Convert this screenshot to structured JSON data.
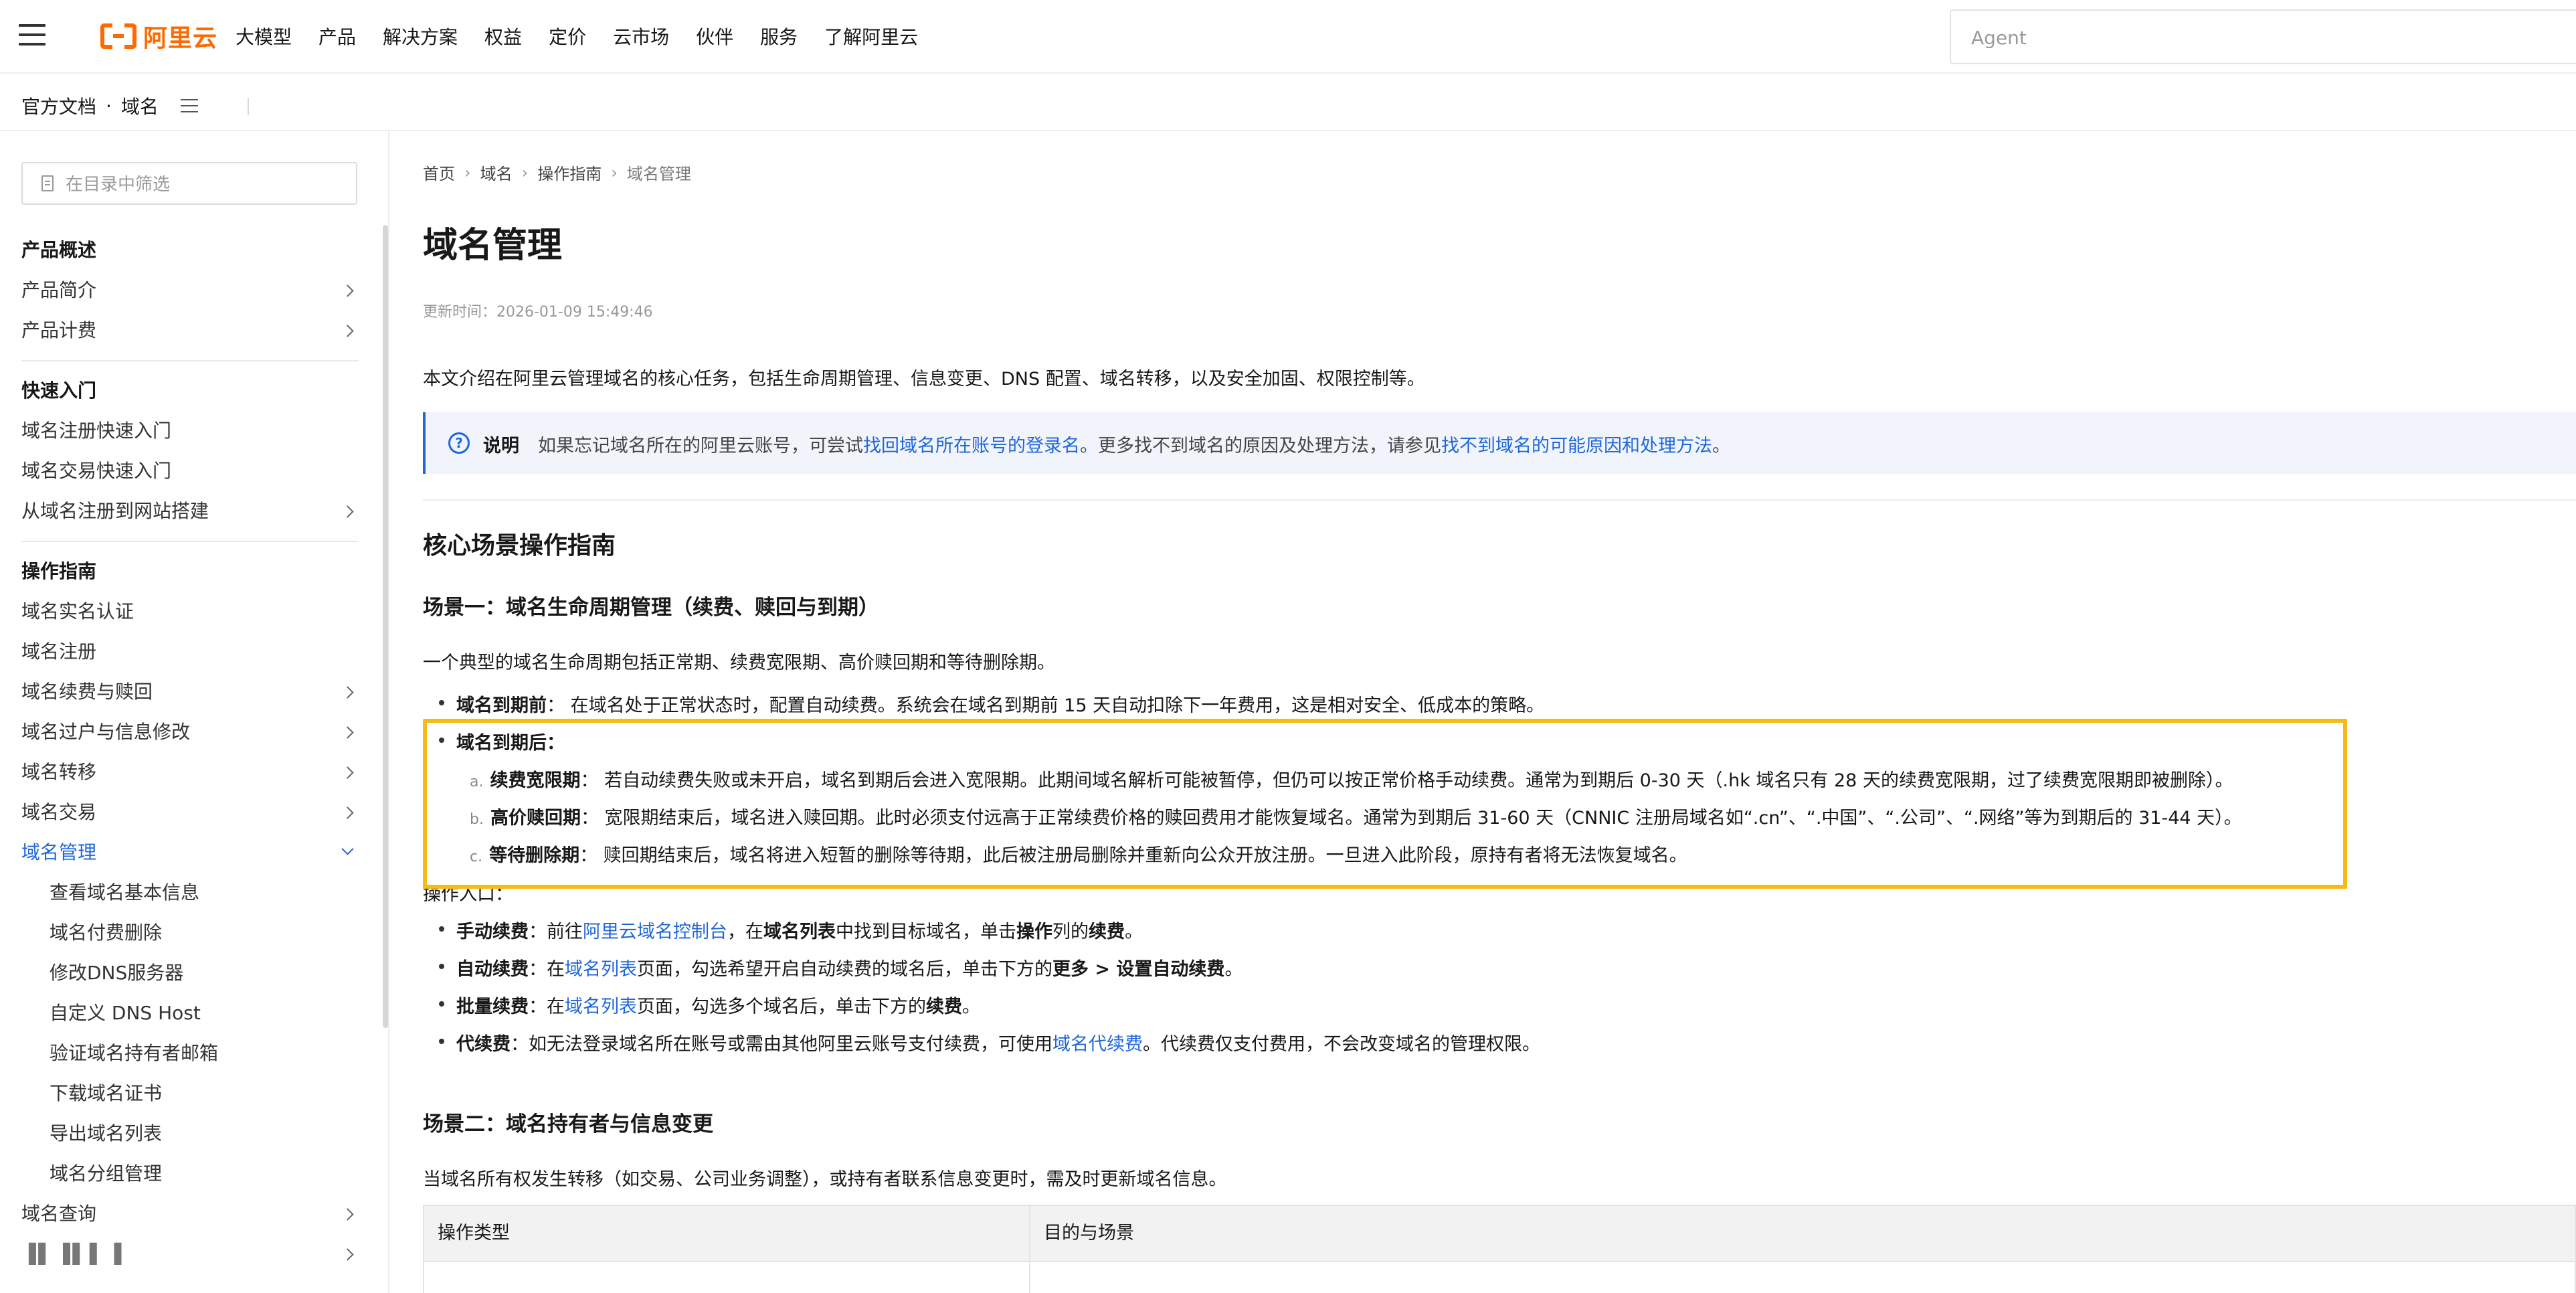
{
  "header": {
    "logo_text": "阿里云",
    "nav": [
      "大模型",
      "产品",
      "解决方案",
      "权益",
      "定价",
      "云市场",
      "伙伴",
      "服务",
      "了解阿里云"
    ],
    "agent_placeholder": "Agent"
  },
  "subheader": {
    "doc_label": "官方文档",
    "separator": "·",
    "product": "域名"
  },
  "sidebar": {
    "filter_placeholder": "在目录中筛选",
    "groups": [
      {
        "title": "产品概述",
        "items": [
          "产品简介",
          "产品计费"
        ]
      },
      {
        "title": "快速入门",
        "items": [
          "域名注册快速入门",
          "域名交易快速入门",
          "从域名注册到网站搭建"
        ]
      },
      {
        "title": "操作指南",
        "items": [
          "域名实名认证",
          "域名注册",
          "域名续费与赎回",
          "域名过户与信息修改",
          "域名转移",
          "域名交易",
          "域名管理"
        ]
      }
    ],
    "active_children": [
      "查看域名基本信息",
      "域名付费删除",
      "修改DNS服务器",
      "自定义 DNS Host",
      "验证域名持有者邮箱",
      "下载域名证书",
      "导出域名列表",
      "域名分组管理"
    ],
    "after_items": [
      "域名查询"
    ],
    "redacted_item": "▐▌▐▌▌▐"
  },
  "breadcrumb": [
    "首页",
    "域名",
    "操作指南",
    "域名管理"
  ],
  "article": {
    "title": "域名管理",
    "updated": "更新时间：2026-01-09 15:49:46",
    "intro": "本文介绍在阿里云管理域名的核心任务，包括生命周期管理、信息变更、DNS 配置、域名转移，以及安全加固、权限控制等。",
    "note": {
      "label": "说明",
      "text_1": "如果忘记域名所在的阿里云账号，可尝试",
      "link_1": "找回域名所在账号的登录名",
      "text_2": "。更多找不到域名的原因及处理方法，请参见",
      "link_2": "找不到域名的可能原因和处理方法",
      "text_3": "。"
    },
    "h2_core": "核心场景操作指南",
    "scene1_title": "场景一：域名生命周期管理（续费、赎回与到期）",
    "scene1_intro": "一个典型的域名生命周期包括正常期、续费宽限期、高价赎回期和等待删除期。",
    "before_expiry": {
      "label": "域名到期前",
      "text": "： 在域名处于正常状态时，配置自动续费。系统会在域名到期前 15 天自动扣除下一年费用，这是相对安全、低成本的策略。"
    },
    "after_expiry_label": "域名到期后：",
    "phases": [
      {
        "marker": "a.",
        "label": "续费宽限期",
        "text": "： 若自动续费失败或未开启，域名到期后会进入宽限期。此期间域名解析可能被暂停，但仍可以按正常价格手动续费。通常为到期后 0-30 天（.hk 域名只有 28 天的续费宽限期，过了续费宽限期即被删除）。"
      },
      {
        "marker": "b.",
        "label": "高价赎回期",
        "text": "： 宽限期结束后，域名进入赎回期。此时必须支付远高于正常续费价格的赎回费用才能恢复域名。通常为到期后 31-60 天（CNNIC 注册局域名如“.cn”、“.中国”、“.公司”、“.网络”等为到期后的 31-44 天）。"
      },
      {
        "marker": "c.",
        "label": "等待删除期",
        "text": "： 赎回期结束后，域名将进入短暂的删除等待期，此后被注册局删除并重新向公众开放注册。一旦进入此阶段，原持有者将无法恢复域名。"
      }
    ],
    "entry_label": "操作入口：",
    "entries": {
      "manual": {
        "label": "手动续费",
        "t1": "：前往",
        "link": "阿里云域名控制台",
        "t2": "，在",
        "b1": "域名列表",
        "t3": "中找到目标域名，单击",
        "b2": "操作",
        "t4": "列的",
        "b3": "续费",
        "t5": "。"
      },
      "auto": {
        "label": "自动续费",
        "t1": "：在",
        "link": "域名列表",
        "t2": "页面，勾选希望开启自动续费的域名后，单击下方的",
        "b1": "更多 > 设置自动续费",
        "t3": "。"
      },
      "batch": {
        "label": "批量续费",
        "t1": "：在",
        "link": "域名列表",
        "t2": "页面，勾选多个域名后，单击下方的",
        "b1": "续费",
        "t3": "。"
      },
      "proxy": {
        "label": "代续费",
        "t1": "：如无法登录域名所在账号或需由其他阿里云账号支付续费，可使用",
        "link": "域名代续费",
        "t2": "。代续费仅支付费用，不会改变域名的管理权限。"
      }
    },
    "scene2_title": "场景二：域名持有者与信息变更",
    "scene2_intro": "当域名所有权发生转移（如交易、公司业务调整），或持有者联系信息变更时，需及时更新域名信息。",
    "table_headers": [
      "操作类型",
      "目的与场景"
    ]
  },
  "colors": {
    "accent": "#ff6a00",
    "link": "#1f66d9",
    "highlight": "#f8bb14"
  }
}
